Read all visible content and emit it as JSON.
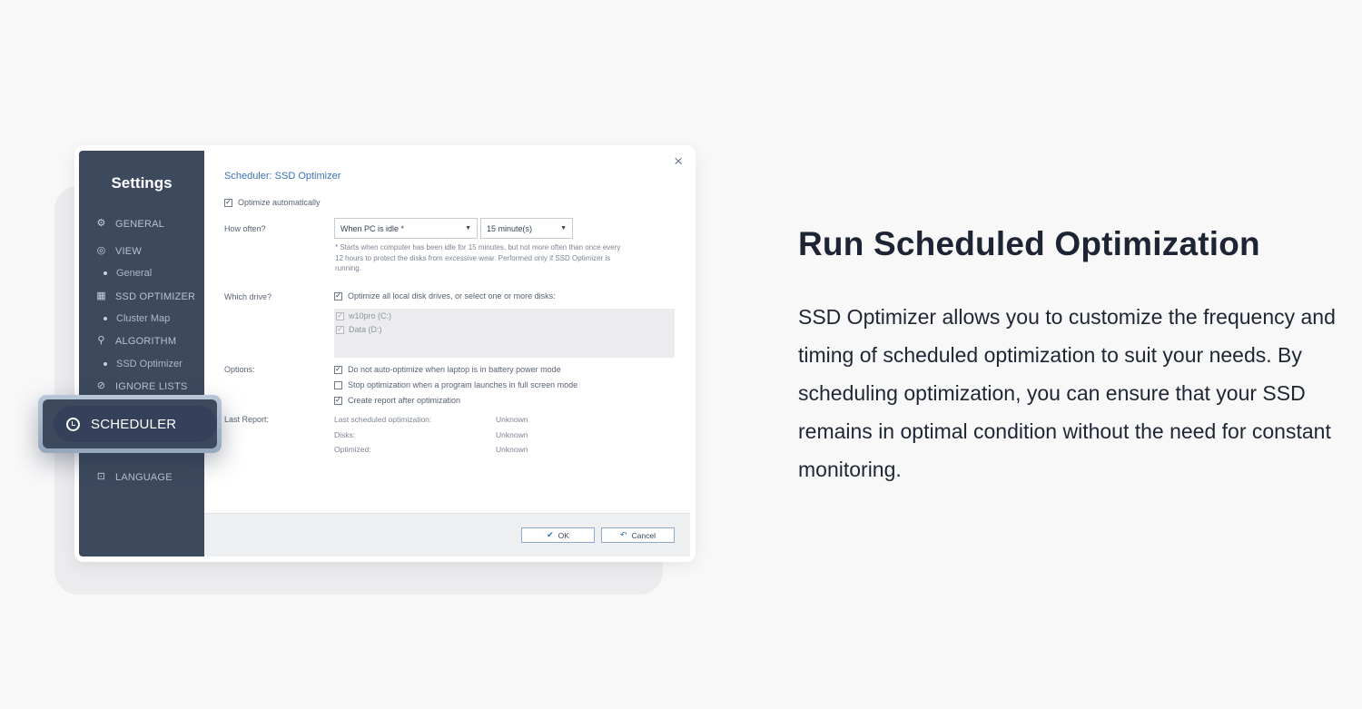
{
  "dialog": {
    "close_icon": "×",
    "sidebar": {
      "title": "Settings",
      "items": [
        {
          "label": "GENERAL",
          "icon": "gear-icon"
        },
        {
          "label": "VIEW",
          "icon": "eye-icon"
        },
        {
          "label": "General",
          "sub": true
        },
        {
          "label": "SSD OPTIMIZER",
          "icon": "grid-icon"
        },
        {
          "label": "Cluster Map",
          "sub": true
        },
        {
          "label": "ALGORITHM",
          "icon": "algorithm-icon"
        },
        {
          "label": "SSD Optimizer",
          "sub": true
        },
        {
          "label": "IGNORE LISTS",
          "icon": "ignore-icon"
        },
        {
          "label": "LANGUAGE",
          "icon": "language-icon"
        }
      ],
      "highlight": {
        "label": "SCHEDULER",
        "icon": "clock-icon"
      }
    },
    "content": {
      "title": "Scheduler: SSD Optimizer",
      "optimize_auto": "Optimize automatically",
      "how_often_label": "How often?",
      "how_often_value": "When PC is idle *",
      "interval_value": "15 minute(s)",
      "note": "* Starts when computer has been idle for 15 minutes, but not more often than once every 12 hours to protect the disks from excessive wear. Performed only if SSD Optimizer is running.",
      "which_drive_label": "Which drive?",
      "all_drives": "Optimize all local disk drives, or select one or more disks:",
      "disks": [
        "w10pro (C:)",
        "Data (D:)"
      ],
      "options_label": "Options:",
      "options": [
        {
          "label": "Do not auto-optimize when laptop is in battery power mode",
          "checked": true
        },
        {
          "label": "Stop optimization when a program launches in full screen mode",
          "checked": false
        },
        {
          "label": "Create report after optimization",
          "checked": true
        }
      ],
      "last_report_label": "Last Report:",
      "report": [
        {
          "key": "Last scheduled optimization:",
          "value": "Unknown"
        },
        {
          "key": "Disks:",
          "value": "Unknown"
        },
        {
          "key": "Optimized:",
          "value": "Unknown"
        }
      ]
    },
    "buttons": {
      "ok": "OK",
      "cancel": "Cancel"
    }
  },
  "feature": {
    "headline": "Run Scheduled Optimization",
    "body": "SSD Optimizer allows you to customize the frequency and timing of scheduled optimization to suit your needs. By scheduling optimization, you can ensure that your SSD remains in optimal condition without the need for constant monitoring."
  },
  "colors": {
    "sidebar": "#3d4a5e",
    "accent": "#3a73b8",
    "background": "#f8f8f9"
  }
}
